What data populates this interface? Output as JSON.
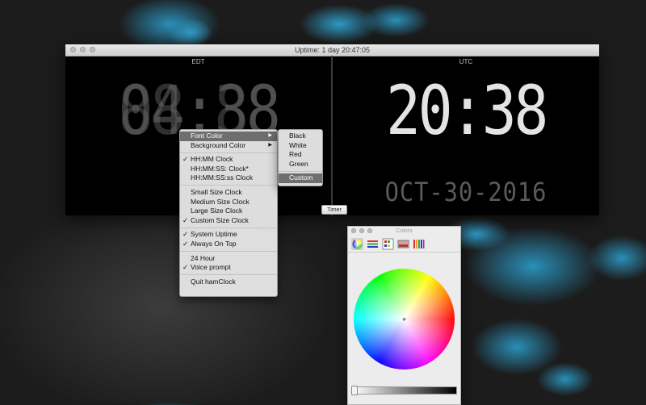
{
  "clock_window": {
    "title": "Uptime: 1 day 20:47:05",
    "left_zone": "EDT",
    "right_zone": "UTC",
    "left_time_ghost": "88:88",
    "left_time": "04:38",
    "right_time": "20:38",
    "date": "OCT-30-2016",
    "digit_color_left": "#2f2f2f",
    "digit_color_right": "#e4e4e4"
  },
  "timer_button": "Timer",
  "context_menu": {
    "items": [
      {
        "label": "Font Color",
        "checked": false,
        "submenu": true,
        "highlighted": true
      },
      {
        "label": "Background Color",
        "checked": false,
        "submenu": true
      },
      {
        "label": "HH:MM Clock",
        "checked": true
      },
      {
        "label": "HH:MM:SS: Clock*",
        "checked": false
      },
      {
        "label": "HH:MM:SS:ss Clock",
        "checked": false
      },
      {
        "label": "Small Size Clock",
        "checked": false
      },
      {
        "label": "Medium Size Clock",
        "checked": false
      },
      {
        "label": "Large Size Clock",
        "checked": false
      },
      {
        "label": "Custom Size Clock",
        "checked": true
      },
      {
        "label": "System Uptime",
        "checked": true
      },
      {
        "label": "Always On Top",
        "checked": true
      },
      {
        "label": "24 Hour",
        "checked": false
      },
      {
        "label": "Voice prompt",
        "checked": true
      },
      {
        "label": "Quit hamClock",
        "checked": false
      }
    ]
  },
  "font_color_submenu": {
    "items": [
      "Black",
      "White",
      "Red",
      "Green",
      "Custom"
    ],
    "highlighted": "Custom"
  },
  "colors_panel": {
    "title": "Colors",
    "tabs": [
      "color-wheel-icon",
      "sliders-icon",
      "palettes-icon",
      "image-palettes-icon",
      "crayons-icon"
    ]
  },
  "check_mark": "✓",
  "submenu_arrow": "▶"
}
